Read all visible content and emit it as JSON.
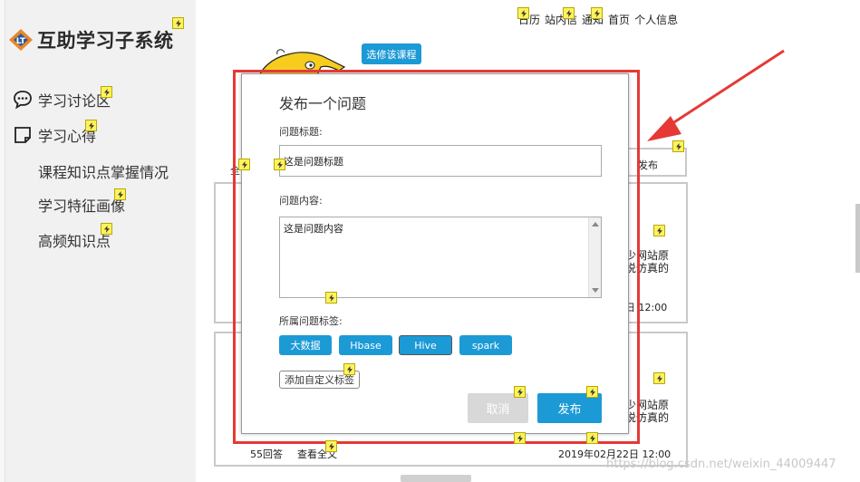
{
  "app": {
    "title": "互助学习子系统"
  },
  "sidebar": {
    "items": [
      {
        "label": "学习讨论区",
        "icon": "chat-bubble-icon"
      },
      {
        "label": "学习心得",
        "icon": "note-icon"
      },
      {
        "label": "课程知识点掌握情况"
      },
      {
        "label": "学习特征画像"
      },
      {
        "label": "高频知识点"
      }
    ]
  },
  "topnav": {
    "items": [
      "日历",
      "站内信",
      "通知",
      "首页",
      "个人信息"
    ]
  },
  "background": {
    "select_course": "选修该课程",
    "publish_partial": "发布",
    "card1": {
      "text1": "少网站原",
      "text2": "说仿真的",
      "time": "日 12:00"
    },
    "card2": {
      "text1": "少网站原",
      "text2": "说仿真的"
    },
    "footer": {
      "answers": "55回答",
      "view_all": "查看全文",
      "date": "2019年02月22日 12:00"
    },
    "left_partial": "全"
  },
  "modal": {
    "title": "发布一个问题",
    "title_label": "问题标题:",
    "title_value": "这是问题标题",
    "content_label": "问题内容:",
    "content_value": "这是问题内容",
    "tags_label": "所属问题标签:",
    "tags": [
      "大数据",
      "Hbase",
      "Hive",
      "spark"
    ],
    "selected_tag": "Hive",
    "add_tag": "添加自定义标签",
    "cancel": "取消",
    "publish": "发布"
  },
  "watermark": "https://blog.csdn.net/weixin_44009447",
  "colors": {
    "accent": "#1c9ad6",
    "annotation": "#e53935",
    "disabled": "#d8d8d8"
  }
}
